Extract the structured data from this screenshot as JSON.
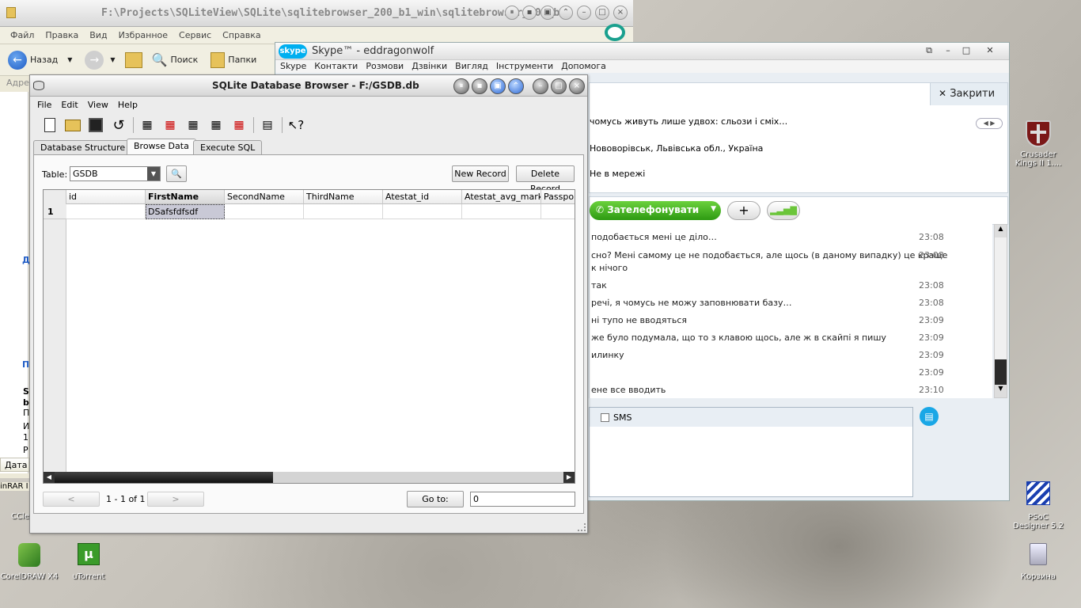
{
  "explorer": {
    "title": "F:\\Projects\\SQLiteView\\SQLite\\sqlitebrowser_200_b1_win\\sqlitebrowser_200_b1",
    "menu": [
      "Файл",
      "Правка",
      "Вид",
      "Избранное",
      "Сервис",
      "Справка"
    ],
    "back_label": "Назад",
    "search_label": "Поиск",
    "folders_label": "Папки",
    "address_label": "Адре",
    "side_label_d": "Д",
    "side_label_p": "П",
    "side_label_s": "S",
    "side_label_b": "b",
    "side_label_g": "П",
    "side_label_i": "И",
    "side_label_1": "1",
    "side_label_r": "Р",
    "date_label": "Дата",
    "partial_winrar": "inRAR I",
    "partial_ccle": "CCle"
  },
  "skype": {
    "title": "Skype™ - eddragonwolf",
    "logo": "skype",
    "menu": [
      "Skype",
      "Контакти",
      "Розмови",
      "Дзвінки",
      "Вигляд",
      "Інструменти",
      "Допомога"
    ],
    "close_label": "Закрити",
    "mood": "чомусь живуть лише удвох: сльози і сміх…",
    "location": "Нововорівськ, Львівська обл., Україна",
    "status": "Не в мережі",
    "call_label": "Зателефонувати",
    "messages": [
      {
        "text": "подобається мені це діло…",
        "time": "23:08"
      },
      {
        "text": "сно? Мені самому це не подобається, але щось (в даному випадку) це краще",
        "time": "23:08"
      },
      {
        "text": "к нічого",
        "time": ""
      },
      {
        "text": "так",
        "time": "23:08"
      },
      {
        "text": "речі, я чомусь не можу заповнювати базу…",
        "time": "23:08"
      },
      {
        "text": "ні тупо не вводяться",
        "time": "23:09"
      },
      {
        "text": "же було подумала, що то з клавою щось, але ж в скайпі я пишу",
        "time": "23:09"
      },
      {
        "text": "илинку",
        "time": "23:09"
      },
      {
        "text": "",
        "time": "23:09"
      },
      {
        "text": "ене все вводить",
        "time": "23:10"
      }
    ],
    "sms_label": "SMS"
  },
  "sqlite": {
    "title": "SQLite Database Browser - F:/GSDB.db",
    "menu": [
      "File",
      "Edit",
      "View",
      "Help"
    ],
    "tabs": [
      "Database Structure",
      "Browse Data",
      "Execute SQL"
    ],
    "table_label": "Table:",
    "table_value": "GSDB",
    "new_record": "New Record",
    "delete_record": "Delete Record",
    "columns": [
      "id",
      "FirstName",
      "SecondName",
      "ThirdName",
      "Atestat_id",
      "Atestat_avg_mark",
      "Passpor"
    ],
    "rows": [
      {
        "num": "1",
        "cells": [
          "",
          "DSafsfdfsdf",
          "",
          "",
          "",
          "",
          ""
        ]
      }
    ],
    "prev": "<",
    "next": ">",
    "record_info": "1 - 1 of 1",
    "goto_label": "Go to:",
    "goto_value": "0"
  },
  "desktop": {
    "icons": [
      {
        "label": "Crusader Kings II 1...."
      },
      {
        "label": "PSoC Designer 5.2"
      },
      {
        "label": "Корзина"
      },
      {
        "label": "CorelDRAW X4"
      },
      {
        "label": "uTorrent"
      }
    ]
  }
}
